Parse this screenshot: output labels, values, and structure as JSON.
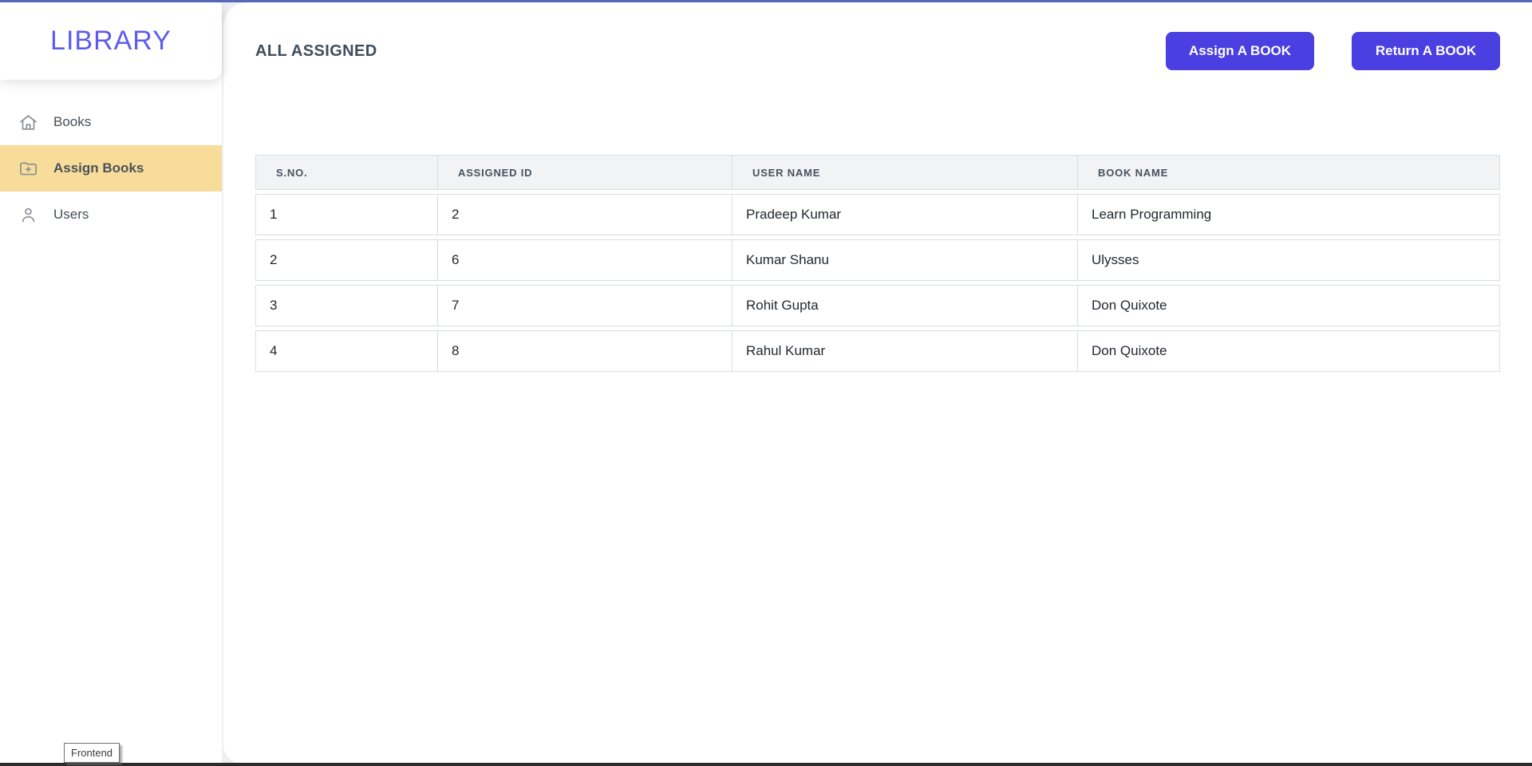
{
  "app": {
    "top_strip_color": "#5768b8",
    "bottom_strip_color": "#2b2b2b"
  },
  "sidebar": {
    "logo": "LIBRARY",
    "logo_color": "#5d5cee",
    "active_bg": "#f8dd9a",
    "items": [
      {
        "label": "Books",
        "icon": "home-icon",
        "active": false
      },
      {
        "label": "Assign Books",
        "icon": "folder-plus-icon",
        "active": true
      },
      {
        "label": "Users",
        "icon": "user-icon",
        "active": false
      }
    ]
  },
  "header": {
    "title": "ALL ASSIGNED",
    "accent": "#4a3fe0",
    "buttons": [
      {
        "label": "Assign A BOOK"
      },
      {
        "label": "Return A BOOK"
      }
    ]
  },
  "table": {
    "columns": [
      "S.NO.",
      "ASSIGNED ID",
      "USER NAME",
      "BOOK NAME"
    ],
    "rows": [
      [
        "1",
        "2",
        "Pradeep Kumar",
        "Learn Programming"
      ],
      [
        "2",
        "6",
        "Kumar Shanu",
        "Ulysses"
      ],
      [
        "3",
        "7",
        "Rohit Gupta",
        "Don Quixote"
      ],
      [
        "4",
        "8",
        "Rahul Kumar",
        "Don Quixote"
      ]
    ]
  },
  "status_badge": {
    "label": "Frontend"
  }
}
